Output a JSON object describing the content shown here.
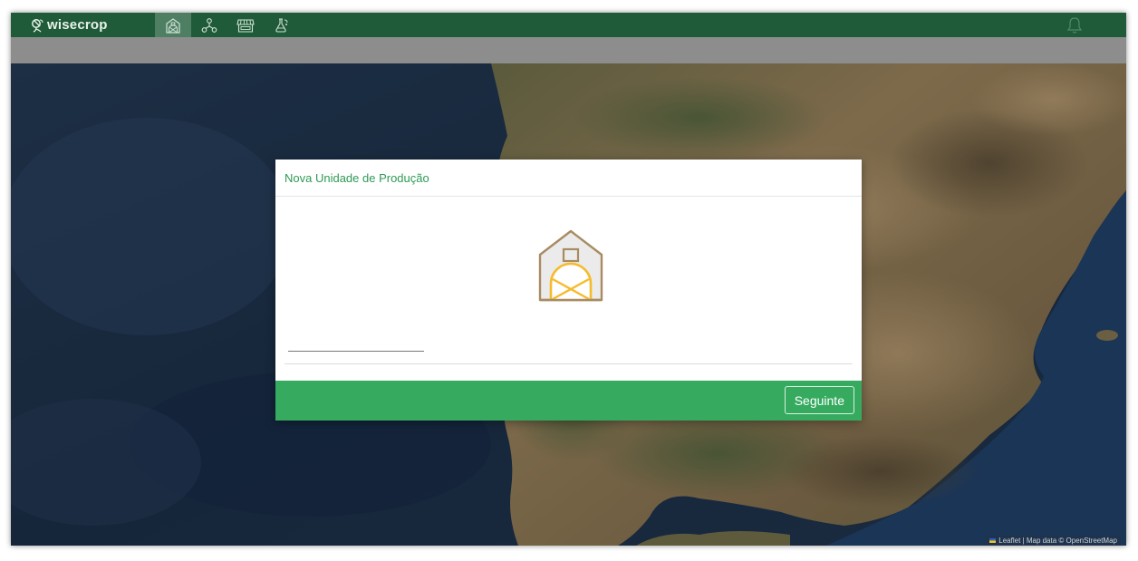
{
  "app": {
    "brand": "wisecrop",
    "accent_color": "#1f5b38",
    "nav_items": [
      {
        "icon": "farm-building-icon",
        "active": true
      },
      {
        "icon": "network-nodes-icon",
        "active": false
      },
      {
        "icon": "market-store-icon",
        "active": false
      },
      {
        "icon": "lab-flask-icon",
        "active": false
      }
    ],
    "notifications_icon": "bell-icon"
  },
  "map": {
    "attribution": "Leaflet | Map data © OpenStreetMap"
  },
  "modal": {
    "title": "Nova Unidade de Produção",
    "illustration_icon": "barn-icon",
    "name_input": {
      "value": "",
      "placeholder": ""
    },
    "next_button": "Seguinte",
    "footer_color": "#36ab60"
  }
}
